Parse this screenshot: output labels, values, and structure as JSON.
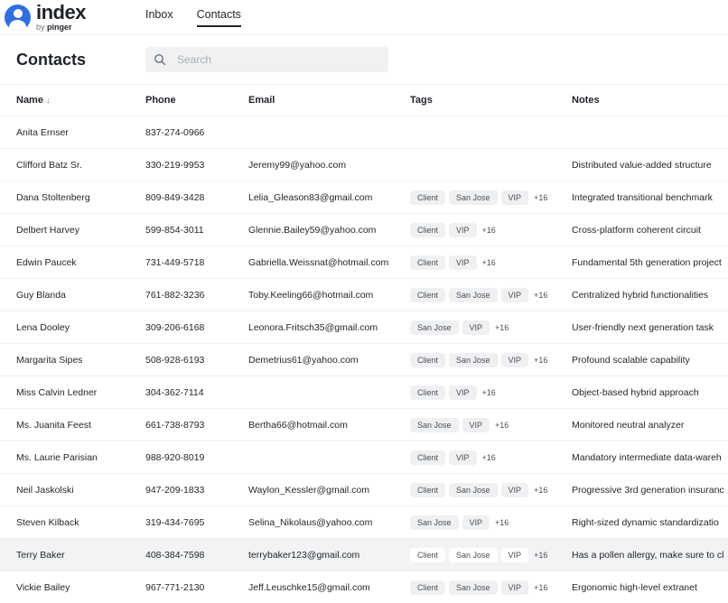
{
  "app": {
    "logo_word": "index",
    "logo_by": "by",
    "logo_company": "pinger"
  },
  "nav": {
    "tabs": [
      {
        "label": "Inbox"
      },
      {
        "label": "Contacts"
      }
    ]
  },
  "header": {
    "title": "Contacts"
  },
  "search": {
    "placeholder": "Search"
  },
  "table": {
    "columns": {
      "name": "Name",
      "phone": "Phone",
      "email": "Email",
      "tags": "Tags",
      "notes": "Notes"
    },
    "sort_icon": "↓",
    "rows": [
      {
        "name": "Anita Ernser",
        "phone": "837-274-0966",
        "email": "",
        "tags": [],
        "more": "",
        "notes": ""
      },
      {
        "name": "Clifford Batz Sr.",
        "phone": "330-219-9953",
        "email": "Jeremy99@yahoo.com",
        "tags": [],
        "more": "",
        "notes": "Distributed value-added structure"
      },
      {
        "name": "Dana Stoltenberg",
        "phone": "809-849-3428",
        "email": "Lelia_Gleason83@gmail.com",
        "tags": [
          "Client",
          "San Jose",
          "VIP"
        ],
        "more": "+16",
        "notes": "Integrated transitional benchmark"
      },
      {
        "name": "Delbert Harvey",
        "phone": "599-854-3011",
        "email": "Glennie.Bailey59@yahoo.com",
        "tags": [
          "Client",
          "VIP"
        ],
        "more": "+16",
        "notes": "Cross-platform coherent circuit"
      },
      {
        "name": "Edwin Paucek",
        "phone": "731-449-5718",
        "email": "Gabriella.Weissnat@hotmail.com",
        "tags": [
          "Client",
          "VIP"
        ],
        "more": "+16",
        "notes": "Fundamental 5th generation project"
      },
      {
        "name": "Guy Blanda",
        "phone": "761-882-3236",
        "email": "Toby.Keeling66@hotmail.com",
        "tags": [
          "Client",
          "San Jose",
          "VIP"
        ],
        "more": "+16",
        "notes": "Centralized hybrid functionalities"
      },
      {
        "name": "Lena Dooley",
        "phone": "309-206-6168",
        "email": "Leonora.Fritsch35@gmail.com",
        "tags": [
          "San Jose",
          "VIP"
        ],
        "more": "+16",
        "notes": "User-friendly next generation task"
      },
      {
        "name": "Margarita Sipes",
        "phone": "508-928-6193",
        "email": "Demetrius61@yahoo.com",
        "tags": [
          "Client",
          "San Jose",
          "VIP"
        ],
        "more": "+16",
        "notes": "Profound scalable capability"
      },
      {
        "name": "Miss Calvin Ledner",
        "phone": "304-362-7114",
        "email": "",
        "tags": [
          "Client",
          "VIP"
        ],
        "more": "+16",
        "notes": "Object-based hybrid approach"
      },
      {
        "name": "Ms. Juanita Feest",
        "phone": "661-738-8793",
        "email": "Bertha66@hotmail.com",
        "tags": [
          "San Jose",
          "VIP"
        ],
        "more": "+16",
        "notes": "Monitored neutral analyzer"
      },
      {
        "name": "Ms. Laurie Parisian",
        "phone": "988-920-8019",
        "email": "",
        "tags": [
          "Client",
          "VIP"
        ],
        "more": "+16",
        "notes": "Mandatory intermediate data-wareh"
      },
      {
        "name": "Neil Jaskolski",
        "phone": "947-209-1833",
        "email": "Waylon_Kessler@gmail.com",
        "tags": [
          "Client",
          "San Jose",
          "VIP"
        ],
        "more": "+16",
        "notes": "Progressive 3rd generation insuranc"
      },
      {
        "name": "Steven Kilback",
        "phone": "319-434-7695",
        "email": "Selina_Nikolaus@yahoo.com",
        "tags": [
          "San Jose",
          "VIP"
        ],
        "more": "+16",
        "notes": "Right-sized dynamic standardizatio"
      },
      {
        "name": "Terry Baker",
        "phone": "408-384-7598",
        "email": "terrybaker123@gmail.com",
        "tags": [
          "Client",
          "San Jose",
          "VIP"
        ],
        "more": "+16",
        "notes": "Has a pollen allergy, make sure to cl"
      },
      {
        "name": "Vickie Bailey",
        "phone": "967-771-2130",
        "email": "Jeff.Leuschke15@gmail.com",
        "tags": [
          "Client",
          "San Jose",
          "VIP"
        ],
        "more": "+16",
        "notes": "Ergonomic high-level extranet"
      }
    ],
    "highlight_row": "Terry Baker"
  }
}
